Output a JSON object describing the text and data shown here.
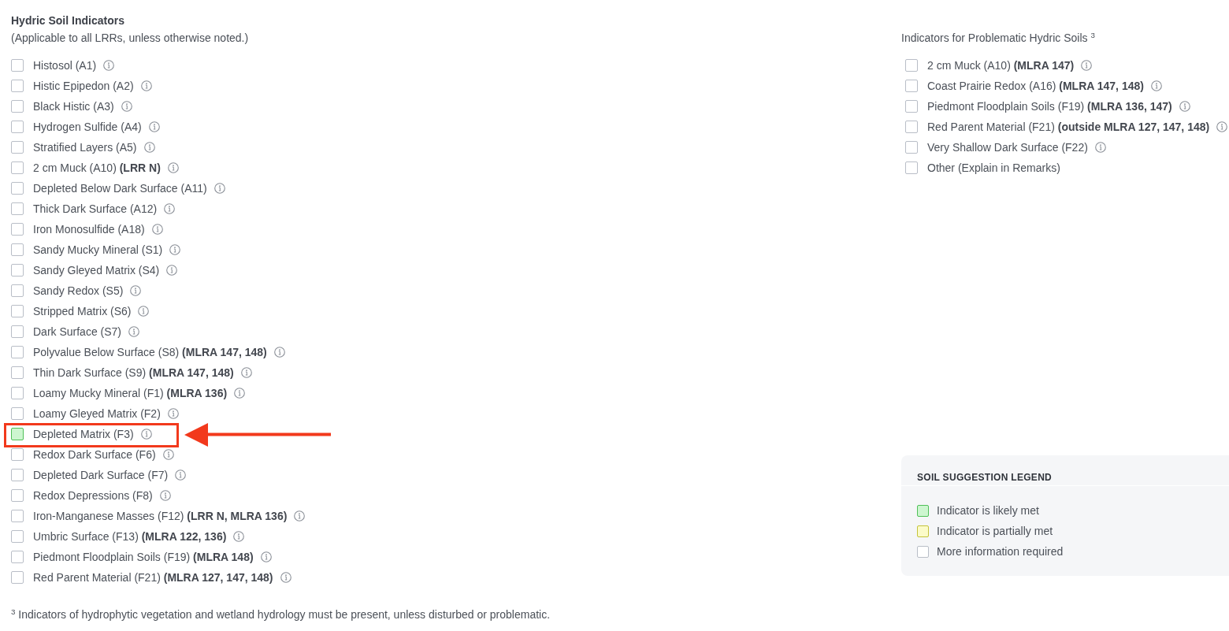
{
  "hydric_soil_indicators": {
    "title": "Hydric Soil Indicators",
    "subtitle": "(Applicable to all LRRs, unless otherwise noted.)",
    "items": [
      {
        "label": "Histosol (A1)",
        "checked": false,
        "color": "#ffffff",
        "info": true,
        "highlighted": false
      },
      {
        "label": "Histic Epipedon (A2)",
        "checked": false,
        "color": "#ffffff",
        "info": true,
        "highlighted": false
      },
      {
        "label": "Black Histic (A3)",
        "checked": false,
        "color": "#ffffff",
        "info": true,
        "highlighted": false
      },
      {
        "label": "Hydrogen Sulfide (A4)",
        "checked": false,
        "color": "#ffffff",
        "info": true,
        "highlighted": false
      },
      {
        "label": "Stratified Layers (A5)",
        "checked": false,
        "color": "#ffffff",
        "info": true,
        "highlighted": false
      },
      {
        "label": "2 cm Muck (A10) **(LRR N)**",
        "checked": false,
        "color": "#ffffff",
        "info": true,
        "highlighted": false
      },
      {
        "label": "Depleted Below Dark Surface (A11)",
        "checked": false,
        "color": "#ffffff",
        "info": true,
        "highlighted": false
      },
      {
        "label": "Thick Dark Surface (A12)",
        "checked": false,
        "color": "#ffffff",
        "info": true,
        "highlighted": false
      },
      {
        "label": "Iron Monosulfide (A18)",
        "checked": false,
        "color": "#ffffff",
        "info": true,
        "highlighted": false
      },
      {
        "label": "Sandy Mucky Mineral (S1)",
        "checked": false,
        "color": "#ffffff",
        "info": true,
        "highlighted": false
      },
      {
        "label": "Sandy Gleyed Matrix (S4)",
        "checked": false,
        "color": "#ffffff",
        "info": true,
        "highlighted": false
      },
      {
        "label": "Sandy Redox (S5)",
        "checked": false,
        "color": "#ffffff",
        "info": true,
        "highlighted": false
      },
      {
        "label": "Stripped Matrix (S6)",
        "checked": false,
        "color": "#ffffff",
        "info": true,
        "highlighted": false
      },
      {
        "label": "Dark Surface (S7)",
        "checked": false,
        "color": "#ffffff",
        "info": true,
        "highlighted": false
      },
      {
        "label": "Polyvalue Below Surface (S8) **(MLRA 147, 148)**",
        "checked": false,
        "color": "#ffffff",
        "info": true,
        "highlighted": false
      },
      {
        "label": "Thin Dark Surface (S9) **(MLRA 147, 148)**",
        "checked": false,
        "color": "#ffffff",
        "info": true,
        "highlighted": false
      },
      {
        "label": "Loamy Mucky Mineral (F1) **(MLRA 136)**",
        "checked": false,
        "color": "#ffffff",
        "info": true,
        "highlighted": false
      },
      {
        "label": "Loamy Gleyed Matrix (F2)",
        "checked": false,
        "color": "#ffffff",
        "info": true,
        "highlighted": false
      },
      {
        "label": "Depleted Matrix (F3)",
        "checked": false,
        "color": "#cdf6d0",
        "info": true,
        "highlighted": true
      },
      {
        "label": "Redox Dark Surface (F6)",
        "checked": false,
        "color": "#ffffff",
        "info": true,
        "highlighted": false
      },
      {
        "label": "Depleted Dark Surface (F7)",
        "checked": false,
        "color": "#ffffff",
        "info": true,
        "highlighted": false
      },
      {
        "label": "Redox Depressions (F8)",
        "checked": false,
        "color": "#ffffff",
        "info": true,
        "highlighted": false
      },
      {
        "label": "Iron-Manganese Masses (F12) **(LRR N, MLRA 136)**",
        "checked": false,
        "color": "#ffffff",
        "info": true,
        "highlighted": false
      },
      {
        "label": "Umbric Surface (F13) **(MLRA 122, 136)**",
        "checked": false,
        "color": "#ffffff",
        "info": true,
        "highlighted": false
      },
      {
        "label": "Piedmont Floodplain Soils (F19) **(MLRA 148)**",
        "checked": false,
        "color": "#ffffff",
        "info": true,
        "highlighted": false
      },
      {
        "label": "Red Parent Material (F21) **(MLRA 127, 147, 148)**",
        "checked": false,
        "color": "#ffffff",
        "info": true,
        "highlighted": false
      }
    ]
  },
  "problematic_indicators": {
    "title": "Indicators for Problematic Hydric Soils $^{3}$",
    "items": [
      {
        "label": "2 cm Muck (A10) **(MLRA 147)**",
        "checked": false,
        "color": "#ffffff",
        "info": true,
        "highlighted": false
      },
      {
        "label": "Coast Prairie Redox (A16) **(MLRA 147, 148)**",
        "checked": false,
        "color": "#ffffff",
        "info": true,
        "highlighted": false
      },
      {
        "label": "Piedmont Floodplain Soils (F19) **(MLRA 136, 147)**",
        "checked": false,
        "color": "#ffffff",
        "info": true,
        "highlighted": false
      },
      {
        "label": "Red Parent Material (F21) **(outside MLRA 127, 147, 148)**",
        "checked": false,
        "color": "#ffffff",
        "info": true,
        "highlighted": false
      },
      {
        "label": "Very Shallow Dark Surface (F22)",
        "checked": false,
        "color": "#ffffff",
        "info": true,
        "highlighted": false
      },
      {
        "label": "Other (Explain in Remarks)",
        "checked": false,
        "color": "#ffffff",
        "info": false,
        "highlighted": false
      }
    ]
  },
  "legend": {
    "title": "SOIL SUGGESTION LEGEND",
    "items": [
      {
        "label": "Indicator is likely met",
        "color": "#cdf6d0"
      },
      {
        "label": "Indicator is partially met",
        "color": "#fbfbc9"
      },
      {
        "label": "More information required",
        "color": "#ffffff"
      }
    ]
  },
  "footnote": "$^{3}$ Indicators of hydrophytic vegetation and wetland hydrology must be present, unless disturbed or problematic."
}
